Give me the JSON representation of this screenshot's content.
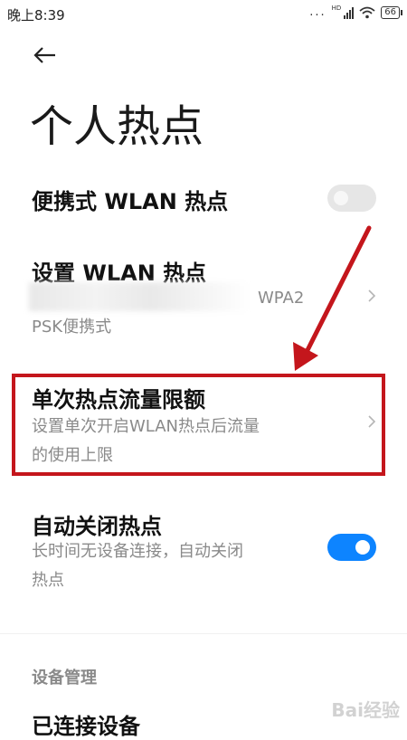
{
  "status_bar": {
    "time": "晚上8:39",
    "dots": "...",
    "network_badge": "HD",
    "battery": "66"
  },
  "header": {
    "back_icon": "back-arrow-icon",
    "title": "个人热点"
  },
  "rows": {
    "portable_hotspot": {
      "title": "便携式 WLAN 热点",
      "toggle_on": false
    },
    "setup_hotspot": {
      "title": "设置 WLAN 热点",
      "security_line1": "WPA2",
      "security_line2": "PSK便携式"
    },
    "data_limit": {
      "title": "单次热点流量限额",
      "sub_line1": "设置单次开启WLAN热点后流量",
      "sub_line2": "的使用上限"
    },
    "auto_close": {
      "title": "自动关闭热点",
      "sub_line1": "长时间无设备连接，自动关闭",
      "sub_line2": "热点",
      "toggle_on": true
    }
  },
  "section": {
    "device_management": "设备管理",
    "connected_devices": "已连接设备"
  },
  "watermark": "Bai经验",
  "colors": {
    "accent_blue": "#0d84ff",
    "annotation_red": "#c4161c",
    "subtitle_gray": "#8a8a8a"
  }
}
